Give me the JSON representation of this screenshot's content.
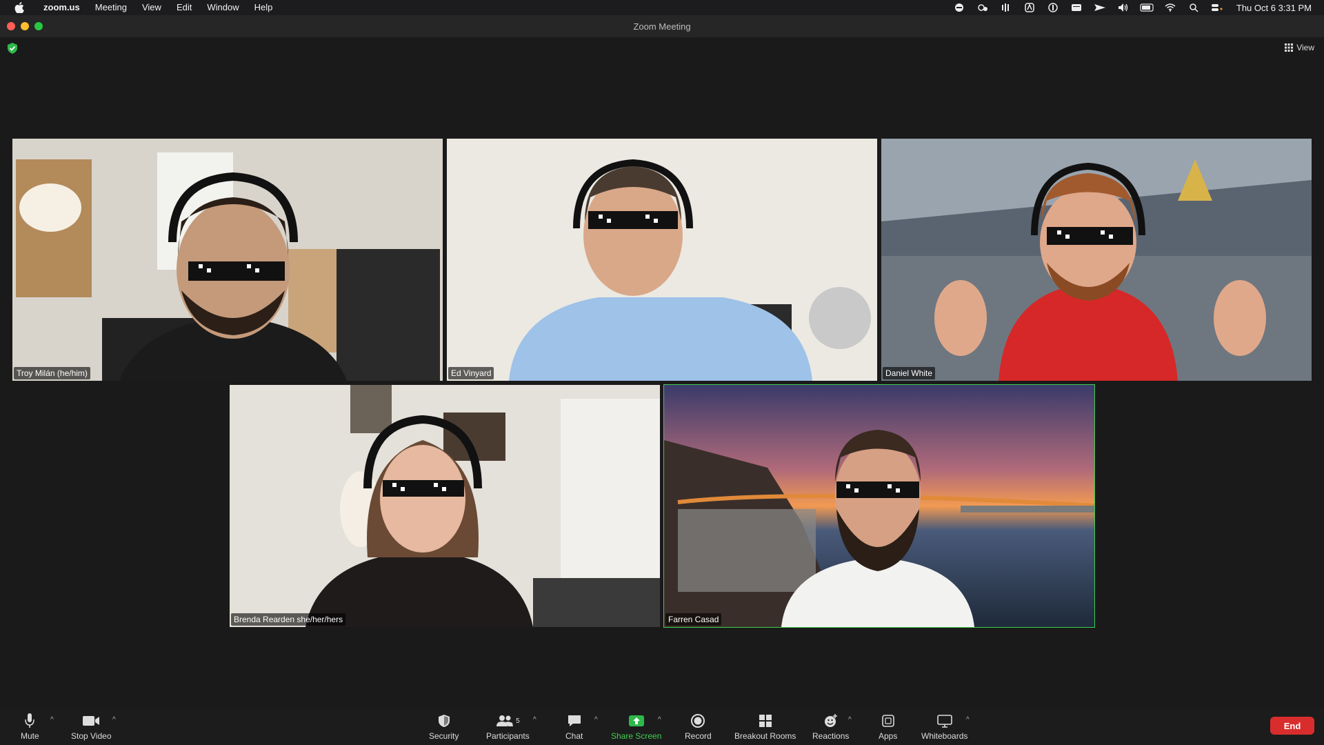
{
  "menubar": {
    "app": "zoom.us",
    "items": [
      "Meeting",
      "View",
      "Edit",
      "Window",
      "Help"
    ],
    "clock": "Thu Oct 6  3:31 PM"
  },
  "window": {
    "title": "Zoom Meeting",
    "view_label": "View"
  },
  "participants": [
    {
      "name": "Troy Milán (he/him)",
      "active": false
    },
    {
      "name": "Ed Vinyard",
      "active": false
    },
    {
      "name": "Daniel White",
      "active": false
    },
    {
      "name": "Brenda Rearden she/her/hers",
      "active": false
    },
    {
      "name": "Farren Casad",
      "active": true
    }
  ],
  "toolbar": {
    "mute": "Mute",
    "stop_video": "Stop Video",
    "security": "Security",
    "participants": "Participants",
    "participants_count": "5",
    "chat": "Chat",
    "share_screen": "Share Screen",
    "record": "Record",
    "breakout_rooms": "Breakout Rooms",
    "reactions": "Reactions",
    "apps": "Apps",
    "whiteboards": "Whiteboards",
    "end": "End"
  },
  "colors": {
    "share_green": "#3fcf4f",
    "end_red": "#d92d2d",
    "active_speaker": "#3fcf4f"
  }
}
